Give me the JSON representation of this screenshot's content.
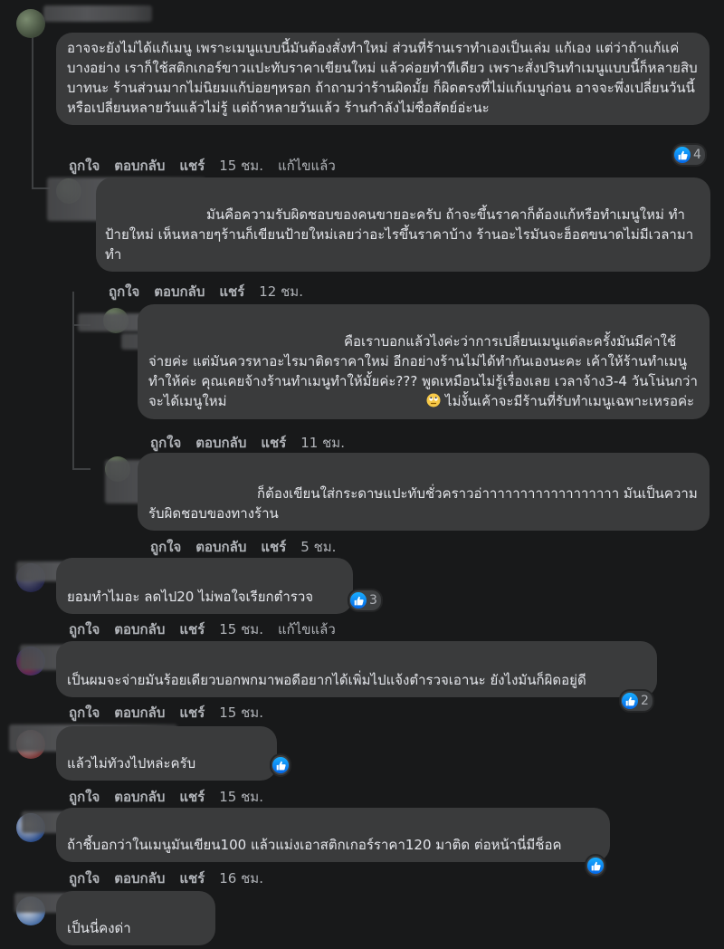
{
  "actions": {
    "like": "ถูกใจ",
    "reply": "ตอบกลับ",
    "share": "แชร์",
    "edited": "แก้ไขแล้ว"
  },
  "comments": [
    {
      "text": "อาจจะยังไม่ได้แก้เมนู เพราะเมนูแบบนี้มันต้องสั่งทำใหม่ ส่วนที่ร้านเราทำเองเป็นเล่ม แก้เอง แต่ว่าถ้าแก้แค่บางอย่าง เราก็ใช้สติกเกอร์ขาวแปะทับราคาเขียนใหม่ แล้วค่อยทำทีเดียว เพราะสั่งปรินทำเมนูแบบนี้ก็หลายสิบบาทนะ ร้านส่วนมากไม่นิยมแก้บ่อยๆหรอก ถ้าถามว่าร้านผิดมั้ย ก็ผิดตรงที่ไม่แก้เมนูก่อน อาจจะพึ่งเปลี่ยนวันนี้ หรือเปลี่ยนหลายวันแล้วไม่รู้ แต่ถ้าหลายวันแล้ว ร้านกำลังไม่ซื่อสัตย์อ่ะนะ",
      "time": "15 ชม.",
      "reactions": "4"
    },
    {
      "text": "มันคือความรับผิดชอบของคนขายอะครับ ถ้าจะขึ้นราคาก็ต้องแก้หรือทำเมนูใหม่ ทำป้ายใหม่ เห็นหลายๆร้านก็เขียนป้ายใหม่เลยว่าอะไรขึ้นราคาบ้าง ร้านอะไรมันจะฮ็อตขนาดไม่มีเวลามาทำ",
      "time": "12 ชม."
    },
    {
      "text": "คือเราบอกแล้วไงค่ะว่าการเปลี่ยนเมนูแต่ละครั้งมันมีค่าใช้จ่ายค่ะ แต่มันควรหาอะไรมาติดราคาใหม่ อีกอย่างร้านไม่ได้ทำกันเองนะคะ เค้าให้ร้านทำเมนูทำให้ค่ะ คุณเคยจ้างร้านทำเมนูทำให้มั้ยค่ะ??? พูดเหมือนไม่รู้เรื่องเลย เวลาจ้าง3-4 วันโน่นกว่าจะได้เมนูใหม่",
      "text_after": " ไม่งั้นเค้าจะมีร้านที่รับทำเมนูเฉพาะเหรอค่ะ",
      "time": "11 ชม."
    },
    {
      "text": "ก็ต้องเขียนใส่กระดาษแปะทับชั่วคราวอ่าาาาาาาาาาาาาาาาาา มันเป็นความรับผิดชอบของทางร้าน",
      "time": "5 ชม."
    },
    {
      "text": "ยอมทำไมอะ ลดไป20 ไม่พอใจเรียกตำรวจ",
      "time": "15 ชม.",
      "reactions": "3"
    },
    {
      "text": "เป็นผมจะจ่ายมันร้อยเดียวบอกพกมาพอดีอยากได้เพิ่มไปแจ้งตำรวจเอานะ ยังไงมันก็ผิดอยู่ดี",
      "time": "15 ชม.",
      "reactions": "2"
    },
    {
      "text": "แล้วไม่ทัวงไปหล่ะครับ",
      "time": "15 ชม."
    },
    {
      "text": "ถ้าชี้บอกว่าในเมนูมันเขียน100 แล้วแม่งเอาสติกเกอร์ราคา120 มาติด ต่อหน้านี่มีช็อค",
      "time": "16 ชม."
    },
    {
      "text": "เป็นนี่คงด่า"
    }
  ],
  "icons": {
    "reaction": "like-icon",
    "emoji": "rolling-eyes-emoji"
  },
  "colors": {
    "background": "#18191a",
    "bubble": "#3a3b3c",
    "text": "#e4e6eb",
    "meta": "#b0b3b8",
    "like_blue": "#1877f2"
  }
}
